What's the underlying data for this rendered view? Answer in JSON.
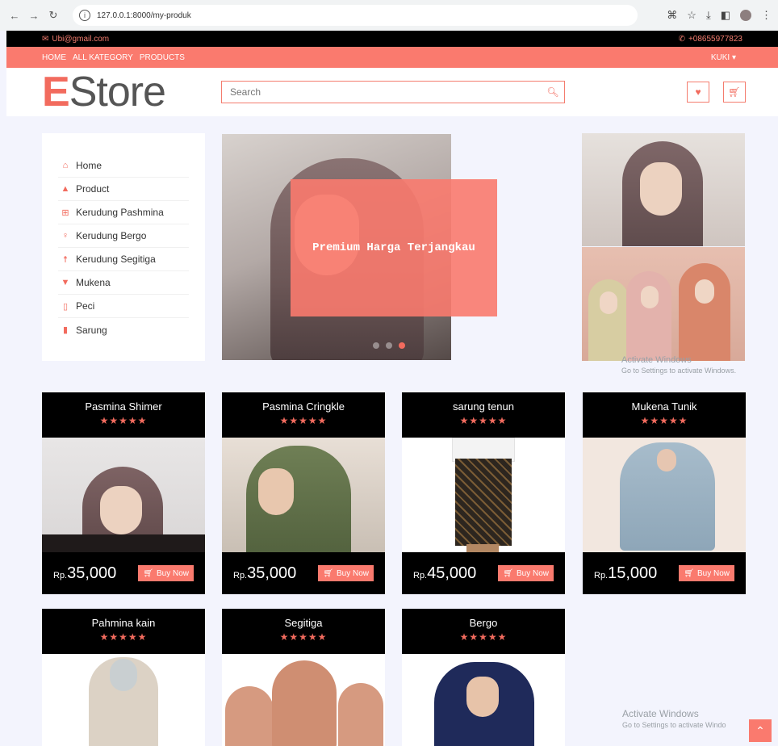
{
  "browser": {
    "url": "127.0.0.1:8000/my-produk"
  },
  "topbar": {
    "email": "Ubi@gmail.com",
    "phone": "+08655977823"
  },
  "nav": {
    "home": "HOME",
    "kategori": "ALL KATEGORY",
    "products": "PRODUCTS",
    "user": "KUKI"
  },
  "header": {
    "logo_e": "E",
    "logo_rest": "Store",
    "search_placeholder": "Search"
  },
  "sidebar": {
    "items": [
      {
        "label": "Home",
        "icon": "home-icon"
      },
      {
        "label": "Product",
        "icon": "bag-icon"
      },
      {
        "label": "Kerudung Pashmina",
        "icon": "plus-square-icon"
      },
      {
        "label": "Kerudung Bergo",
        "icon": "female-icon"
      },
      {
        "label": "Kerudung Segitiga",
        "icon": "child-icon"
      },
      {
        "label": "Mukena",
        "icon": "shirt-icon"
      },
      {
        "label": "Peci",
        "icon": "mobile-icon"
      },
      {
        "label": "Sarung",
        "icon": "battery-icon"
      }
    ]
  },
  "carousel": {
    "caption": "Premium Harga Terjangkau"
  },
  "products": [
    {
      "name": "Pasmina Shimer",
      "currency": "Rp.",
      "price": "35,000",
      "buy": "Buy Now"
    },
    {
      "name": "Pasmina Cringkle",
      "currency": "Rp.",
      "price": "35,000",
      "buy": "Buy Now"
    },
    {
      "name": "sarung tenun",
      "currency": "Rp.",
      "price": "45,000",
      "buy": "Buy Now"
    },
    {
      "name": "Mukena Tunik",
      "currency": "Rp.",
      "price": "15,000",
      "buy": "Buy Now"
    },
    {
      "name": "Pahmina kain"
    },
    {
      "name": "Segitiga"
    },
    {
      "name": "Bergo"
    }
  ],
  "stars": "★★★★★",
  "watermark": {
    "title": "Activate Windows",
    "sub": "Go to Settings to activate Windows.",
    "sub2": "Go to Settings to activate Windo"
  },
  "colors": {
    "accent": "#fa7a6e",
    "dark": "#000000",
    "bg": "#f3f4fd"
  }
}
